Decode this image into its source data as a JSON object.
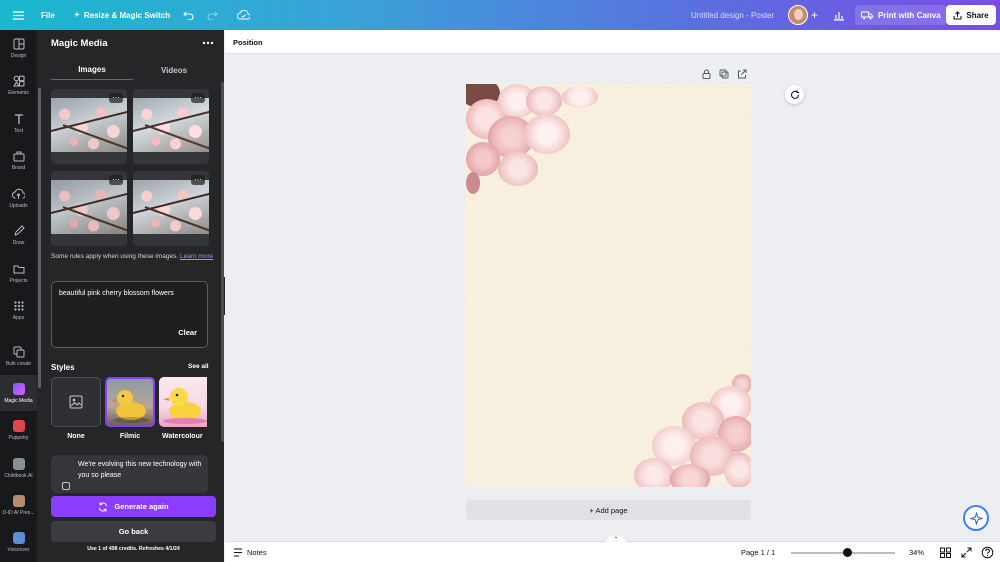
{
  "topbar": {
    "file": "File",
    "resize": "Resize & Magic Switch",
    "title": "Untitled design - Poster",
    "print": "Print with Canva",
    "share": "Share"
  },
  "rail": [
    {
      "label": "Design",
      "icon": "design-icon"
    },
    {
      "label": "Elements",
      "icon": "elements-icon"
    },
    {
      "label": "Text",
      "icon": "text-icon"
    },
    {
      "label": "Brand",
      "icon": "brand-icon"
    },
    {
      "label": "Uploads",
      "icon": "uploads-icon"
    },
    {
      "label": "Draw",
      "icon": "draw-icon"
    },
    {
      "label": "Projects",
      "icon": "projects-icon"
    },
    {
      "label": "Apps",
      "icon": "apps-icon"
    },
    {
      "label": "Bulk create",
      "icon": "bulk-create-icon"
    },
    {
      "label": "Magic Media",
      "icon": "magic-media-icon"
    },
    {
      "label": "Puppetry",
      "icon": "puppetry-icon"
    },
    {
      "label": "Childbook.AI",
      "icon": "childbook-icon"
    },
    {
      "label": "D-ID AI Pres...",
      "icon": "d-id-icon"
    },
    {
      "label": "Voiceover",
      "icon": "voiceover-icon"
    }
  ],
  "panel": {
    "title": "Magic Media",
    "tabs": [
      "Images",
      "Videos"
    ],
    "rules_text": "Some rules apply when using these images.",
    "learn_more": "Learn more",
    "prompt": "beautiful pink cherry blossom flowers",
    "clear": "Clear",
    "styles_title": "Styles",
    "see_all": "See all",
    "styles": [
      "None",
      "Filmic",
      "Watercolour"
    ],
    "notice": "We're evolving this new technology with you so please",
    "generate": "Generate again",
    "go_back": "Go back",
    "credits": "Use 1 of 498 credits. Refreshes 4/1/24"
  },
  "editor": {
    "position": "Position",
    "add_page": "+ Add page"
  },
  "bottom": {
    "notes": "Notes",
    "page": "Page 1 / 1",
    "zoom": "34%",
    "zoom_level": 0.34
  }
}
